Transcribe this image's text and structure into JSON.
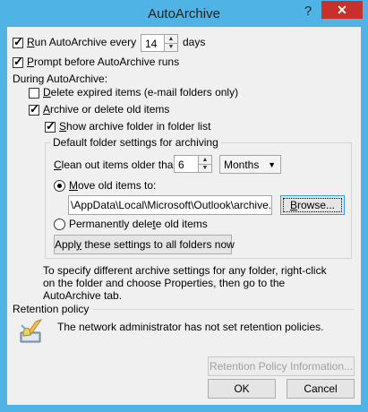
{
  "window": {
    "title": "AutoArchive",
    "help_label": "?",
    "close_label": "✕"
  },
  "run_every": {
    "checked": true,
    "label_pre": "",
    "label_u": "R",
    "label_post": "un AutoArchive every",
    "days_value": "14",
    "days_label": "days"
  },
  "prompt_before": {
    "checked": true,
    "label_u": "P",
    "label_post": "rompt before AutoArchive runs"
  },
  "during_label": "During AutoArchive:",
  "delete_expired": {
    "checked": false,
    "label_u": "D",
    "label_post": "elete expired items (e-mail folders only)"
  },
  "archive_or_delete": {
    "checked": true,
    "label_u": "A",
    "label_post": "rchive or delete old items"
  },
  "show_archive_folder": {
    "checked": true,
    "label_u": "S",
    "label_post": "how archive folder in folder list"
  },
  "defaults_group": {
    "title": "Default folder settings for archiving",
    "clean_out_u": "C",
    "clean_out_post": "lean out items older than",
    "age_value": "6",
    "unit_value": "Months",
    "move_old_u": "M",
    "move_old_post": "ove old items to:",
    "archive_path": "\\AppData\\Local\\Microsoft\\Outlook\\archive.pst",
    "browse_label": "Browse...",
    "browse_u": "B",
    "browse_post": "rowse...",
    "perm_delete_pre": "Permanently dele",
    "perm_delete_u": "t",
    "perm_delete_post": "e old items",
    "apply_pre": "Appl",
    "apply_u": "y",
    "apply_post": " these settings to all folders now"
  },
  "info_text_1": "To specify different archive settings for any folder, right-click",
  "info_text_2": "on the folder and choose Properties, then go to the",
  "info_text_3": "AutoArchive tab.",
  "retention": {
    "title": "Retention policy",
    "message": "The network administrator has not set retention policies.",
    "icon": "retention-policy-icon",
    "info_button": "Retention Policy Information..."
  },
  "footer": {
    "ok_label": "OK",
    "cancel_label": "Cancel"
  }
}
